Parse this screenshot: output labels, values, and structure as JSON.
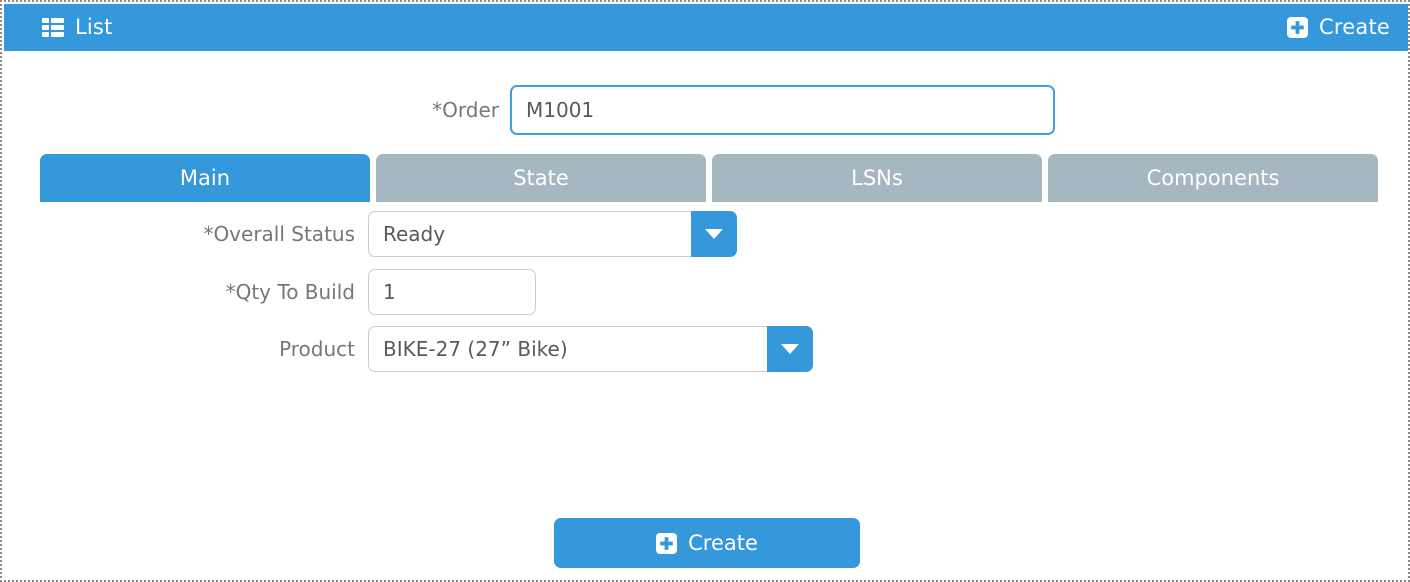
{
  "header": {
    "list_label": "List",
    "list_icon": "list-grid-icon",
    "create_label": "Create",
    "create_icon": "plus-square-icon",
    "background_color": "#3498db",
    "text_color": "#ffffff"
  },
  "order": {
    "label": "*Order",
    "value": "M1001",
    "placeholder": "",
    "focused": true,
    "focus_border_color": "#3fa0e0"
  },
  "tabs": {
    "active_index": 0,
    "active_color": "#3498db",
    "inactive_color": "#a6b7c1",
    "items": [
      {
        "label": "Main"
      },
      {
        "label": "State"
      },
      {
        "label": "LSNs"
      },
      {
        "label": "Components"
      }
    ]
  },
  "fields": {
    "overall_status": {
      "label": "*Overall Status",
      "value": "Ready",
      "placeholder": "",
      "dropdown_icon": "caret-down-icon"
    },
    "qty_to_build": {
      "label": "*Qty To Build",
      "value": "1",
      "placeholder": ""
    },
    "product": {
      "label": "Product",
      "value": "BIKE-27 (27” Bike)",
      "placeholder": "",
      "dropdown_icon": "caret-down-icon"
    }
  },
  "submit": {
    "label": "Create",
    "icon": "plus-square-icon",
    "background_color": "#3498db"
  }
}
